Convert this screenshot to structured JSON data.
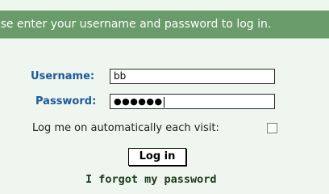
{
  "header": {
    "message": "ase enter your username and password to log in."
  },
  "form": {
    "username_label": "Username:",
    "username_value": "bb",
    "password_label": "Password:",
    "password_value": "●●●●●●",
    "auto_login_label": "Log me on automatically each visit:",
    "auto_login_checked": false,
    "login_button": "Log in",
    "forgot_link": "I forgot my password"
  },
  "colors": {
    "header_bg": "#6a9b6a",
    "page_bg": "#eef6ef",
    "label_blue": "#1d5a9a"
  }
}
